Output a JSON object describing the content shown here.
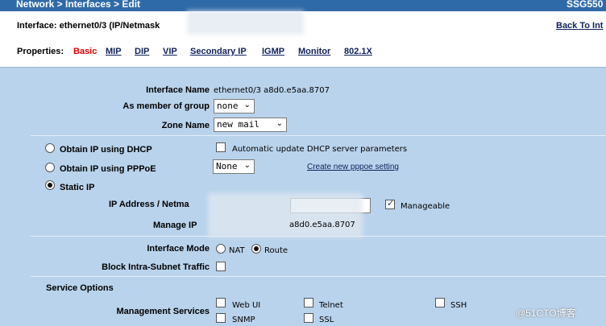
{
  "header": {
    "breadcrumb": "Network > Interfaces > Edit",
    "model": "SSG550"
  },
  "interface_line": "Interface: ethernet0/3 (IP/Netmask",
  "back_link": "Back To Int",
  "properties": {
    "label": "Properties:",
    "tabs": [
      "Basic",
      "MIP",
      "DIP",
      "VIP",
      "Secondary IP",
      "IGMP",
      "Monitor",
      "802.1X"
    ],
    "active": "Basic"
  },
  "form": {
    "interface_name_label": "Interface Name",
    "interface_name_value": "ethernet0/3 a8d0.e5aa.8707",
    "member_group_label": "As member of group",
    "member_group_value": "none",
    "zone_name_label": "Zone Name",
    "zone_name_value": "new mail",
    "dhcp_label": "Obtain IP using DHCP",
    "dhcp_auto_label": "Automatic update DHCP server parameters",
    "pppoe_label": "Obtain IP using PPPoE",
    "pppoe_value": "None",
    "pppoe_link": "Create new pppoe setting",
    "static_label": "Static IP",
    "ip_address_label": "IP Address / Netma",
    "manageable_label": "Manageable",
    "manage_ip_label": "Manage IP",
    "manage_ip_value": "a8d0.e5aa.8707",
    "interface_mode_label": "Interface Mode",
    "mode_nat": "NAT",
    "mode_route": "Route",
    "block_label": "Block Intra-Subnet Traffic",
    "service_options_label": "Service Options",
    "management_services_label": "Management Services",
    "services": [
      "Web UI",
      "Telnet",
      "SSH",
      "SNMP",
      "SSL"
    ]
  },
  "watermark": "@51CTO博客",
  "colors": {
    "header_bg": "#2f6aa8",
    "panel_bg": "#b9d3ec",
    "active_tab": "#dd0000",
    "link": "#10215c"
  }
}
